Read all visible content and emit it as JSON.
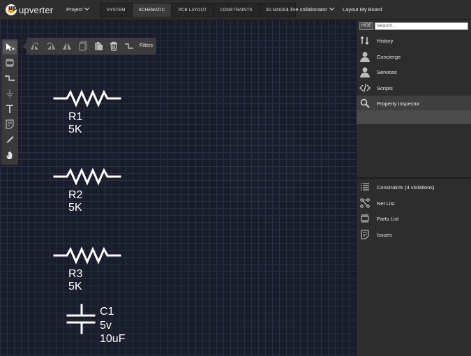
{
  "app": {
    "name": "upverter",
    "logo_glyph": "up"
  },
  "topbar": {
    "project_menu": "Project",
    "modes": [
      "SYSTEM",
      "SCHEMATIC",
      "PCB LAYOUT",
      "CONSTRAINTS",
      "3D MODEL"
    ],
    "active_mode": "SCHEMATIC",
    "collaborators": "1 live collaborator",
    "layout_board": "Layout My Board"
  },
  "left_toolbar": {
    "tools": [
      "select-tool-icon",
      "part-tool-icon",
      "wire-tool-icon",
      "ground-tool-icon",
      "text-tool-icon",
      "note-tool-icon",
      "pen-tool-icon",
      "hand-tool-icon"
    ],
    "active_tool": "select-tool-icon"
  },
  "float_toolbar": {
    "tools": [
      "rotate-left-icon",
      "rotate-right-icon",
      "flip-icon",
      "copy-icon",
      "paste-icon",
      "delete-icon",
      "wire-icon"
    ],
    "filters_label": "Filters"
  },
  "schematic": {
    "components": [
      {
        "ref": "R1",
        "value": "5K",
        "kind": "resistor"
      },
      {
        "ref": "R2",
        "value": "5K",
        "kind": "resistor"
      },
      {
        "ref": "R3",
        "value": "5K",
        "kind": "resistor"
      },
      {
        "ref": "C1",
        "value": "5v",
        "value2": "10uF",
        "kind": "capacitor"
      }
    ]
  },
  "right_panel": {
    "hide_label": "HIDE",
    "search_placeholder": "Search...",
    "items_top": [
      {
        "label": "History",
        "icon": "history-icon"
      },
      {
        "label": "Concierge",
        "icon": "concierge-user-icon"
      },
      {
        "label": "Services",
        "icon": "services-user-icon"
      },
      {
        "label": "Scripts",
        "icon": "code-icon"
      },
      {
        "label": "Property Inspector",
        "icon": "magnifier-icon"
      }
    ],
    "selected_item": "Property Inspector",
    "items_bottom": [
      {
        "label": "Constraints (4 violations)",
        "icon": "list-icon"
      },
      {
        "label": "Net List",
        "icon": "netlist-icon"
      },
      {
        "label": "Parts List",
        "icon": "chip-icon"
      },
      {
        "label": "Issues",
        "icon": "note-icon"
      }
    ]
  },
  "colors": {
    "canvas_bg": "#191c2a",
    "grid": "#2a2e40",
    "panel_bg": "#2d2d2d",
    "logo_accent": "#f0a020",
    "schematic_stroke": "#ffffff"
  }
}
